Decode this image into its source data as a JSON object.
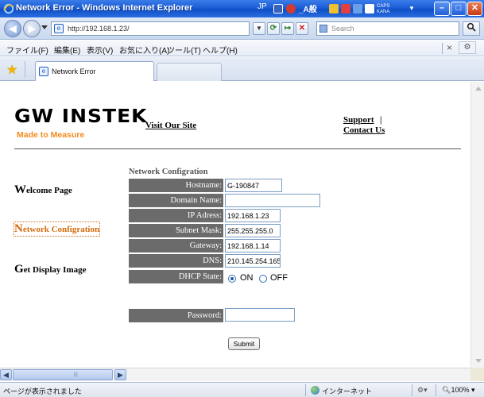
{
  "window": {
    "title": "Network Error - Windows Internet Explorer",
    "tray_prefix": "JP",
    "tray_text": "_A般",
    "tray_small": "CAPS KANA"
  },
  "addressbar": {
    "url": "http://192.168.1.23/",
    "search_placeholder": "Search"
  },
  "menubar": {
    "items": [
      "ファイル(F)",
      "編集(E)",
      "表示(V)",
      "お気に入り(A)",
      "ツール(T)",
      "ヘルプ(H)"
    ]
  },
  "tabs": [
    {
      "label": "Network Error"
    }
  ],
  "page": {
    "logo_text": "GW INSTEK",
    "logo_tagline": "Made to Measure",
    "visit_link": "Visit Our Site",
    "support_link": "Support",
    "support_sep": "|",
    "contact_link": "Contact Us",
    "sidebar": [
      {
        "cap": "W",
        "rest": "elcome Page"
      },
      {
        "cap": "N",
        "rest": "etwork Configration"
      },
      {
        "cap": "G",
        "rest": "et Display Image"
      }
    ],
    "form": {
      "title": "Network Configration",
      "fields": [
        {
          "label": "Hostname:",
          "value": "G-190847"
        },
        {
          "label": "Domain Name:",
          "value": ""
        },
        {
          "label": "IP Adress:",
          "value": "192.168.1.23"
        },
        {
          "label": "Subnet Mask:",
          "value": "255.255.255.0"
        },
        {
          "label": "Gateway:",
          "value": "192.168.1.14"
        },
        {
          "label": "DNS:",
          "value": "210.145.254.165"
        }
      ],
      "dhcp_label": "DHCP State:",
      "dhcp_on": "ON",
      "dhcp_off": "OFF",
      "dhcp_selected": "ON",
      "password_label": "Password:",
      "password_value": "",
      "submit_label": "Submit"
    }
  },
  "statusbar": {
    "status": "ページが表示されました",
    "zone": "インターネット",
    "zoom": "100%"
  }
}
